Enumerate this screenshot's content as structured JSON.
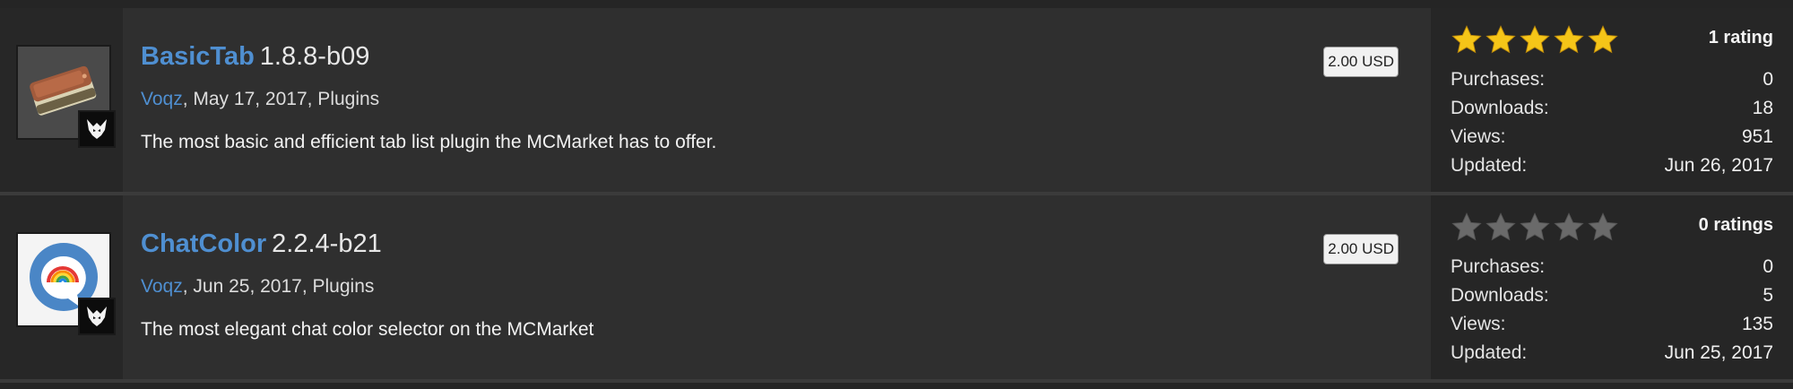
{
  "resources": [
    {
      "title": "BasicTab",
      "version": "1.8.8-b09",
      "author": "Voqz",
      "meta_rest": ", May 17, 2017, Plugins",
      "description": "The most basic and efficient tab list plugin the MCMarket has to offer.",
      "price": "2.00 USD",
      "rating_stars": 5,
      "rating_text": "1 rating",
      "thumb_icon": "tab-device-icon",
      "stats": [
        {
          "label": "Purchases:",
          "value": "0"
        },
        {
          "label": "Downloads:",
          "value": "18"
        },
        {
          "label": "Views:",
          "value": "951"
        },
        {
          "label": "Updated:",
          "value": "Jun 26, 2017"
        }
      ]
    },
    {
      "title": "ChatColor",
      "version": "2.2.4-b21",
      "author": "Voqz",
      "meta_rest": ", Jun 25, 2017, Plugins",
      "description": "The most elegant chat color selector on the MCMarket",
      "price": "2.00 USD",
      "rating_stars": 0,
      "rating_text": "0 ratings",
      "thumb_icon": "rainbow-chat-bubble-icon",
      "stats": [
        {
          "label": "Purchases:",
          "value": "0"
        },
        {
          "label": "Downloads:",
          "value": "5"
        },
        {
          "label": "Views:",
          "value": "135"
        },
        {
          "label": "Updated:",
          "value": "Jun 25, 2017"
        }
      ]
    }
  ],
  "colors": {
    "link": "#4f8fd1",
    "star_filled": "#f5c518",
    "star_empty": "#6a6a6a",
    "row_bg": "#2f2f2f"
  }
}
